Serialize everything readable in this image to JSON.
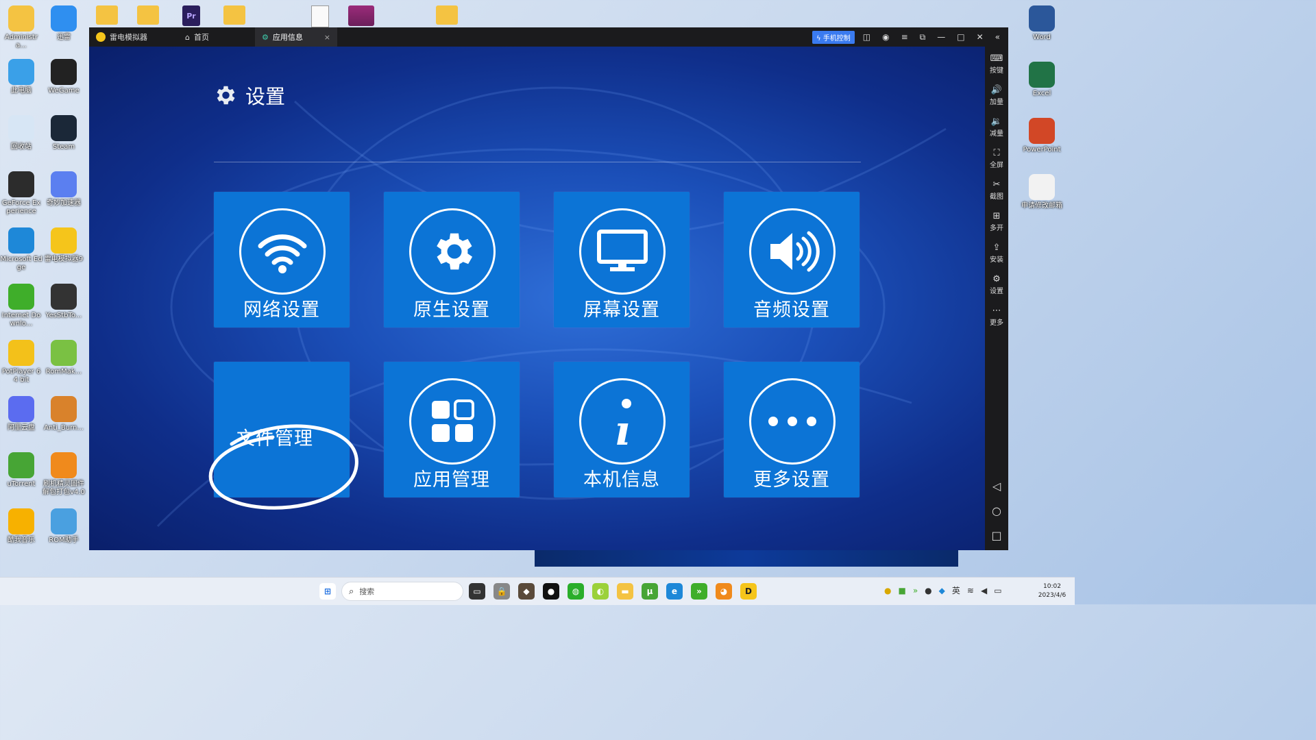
{
  "desktop_left": [
    {
      "label": "Administra...",
      "icon": "folder-icon",
      "color": "#f4c342"
    },
    {
      "label": "迅雷",
      "icon": "xunlei-icon",
      "color": "#2f8ff0"
    },
    {
      "label": "此电脑",
      "icon": "computer-icon",
      "color": "#3aa0e8"
    },
    {
      "label": "WeGame",
      "icon": "wegame-icon",
      "color": "#222222"
    },
    {
      "label": "回收站",
      "icon": "recycle-bin-icon",
      "color": "#d7e6f5"
    },
    {
      "label": "Steam",
      "icon": "steam-icon",
      "color": "#1b2838"
    },
    {
      "label": "GeForce Experience",
      "icon": "geforce-icon",
      "color": "#2c2c2c"
    },
    {
      "label": "奇妙加速器",
      "icon": "accelerator-icon",
      "color": "#5b7ff0"
    },
    {
      "label": "Microsoft Edge",
      "icon": "edge-icon",
      "color": "#1e88d8"
    },
    {
      "label": "雷电模拟器9",
      "icon": "ldplayer-icon",
      "color": "#f5c51b"
    },
    {
      "label": "Internet Downlo...",
      "icon": "idm-icon",
      "color": "#3fae2a"
    },
    {
      "label": "YesStbTo...",
      "icon": "chip-icon",
      "color": "#333333"
    },
    {
      "label": "PotPlayer 64 bit",
      "icon": "potplayer-icon",
      "color": "#f3c11a"
    },
    {
      "label": "RomMak...",
      "icon": "android-icon",
      "color": "#7ac143"
    },
    {
      "label": "阿里云盘",
      "icon": "aliyun-icon",
      "color": "#5b6cf0"
    },
    {
      "label": "Anti_Burn...",
      "icon": "antiburn-icon",
      "color": "#d9822b"
    },
    {
      "label": "uTorrent",
      "icon": "utorrent-icon",
      "color": "#47a535"
    },
    {
      "label": "刷机精灵固件解包打包v4.0",
      "icon": "fox-icon",
      "color": "#f08a1c"
    },
    {
      "label": "酷我音乐",
      "icon": "kuwo-icon",
      "color": "#f7b100"
    },
    {
      "label": "ROM助手",
      "icon": "mushroom-icon",
      "color": "#4aa0e0"
    }
  ],
  "desktop_right": [
    {
      "label": "Word",
      "icon": "word-icon",
      "color": "#2b579a"
    },
    {
      "label": "Excel",
      "icon": "excel-icon",
      "color": "#217346"
    },
    {
      "label": "PowerPoint",
      "icon": "powerpoint-icon",
      "color": "#d24726"
    },
    {
      "label": "申请修改邮箱",
      "icon": "document-icon",
      "color": "#f2f2f2"
    }
  ],
  "titlebar": {
    "app_name": "雷电模拟器",
    "tab_home": "首页",
    "tab_app": "应用信息",
    "phone_control": "手机控制"
  },
  "sidebar": [
    "按键",
    "加量",
    "减量",
    "全屏",
    "截图",
    "多开",
    "安装",
    "设置",
    "更多"
  ],
  "settings": {
    "title": "设置",
    "tiles": [
      {
        "label": "网络设置",
        "icon": "wifi-icon"
      },
      {
        "label": "原生设置",
        "icon": "gear-icon"
      },
      {
        "label": "屏幕设置",
        "icon": "monitor-icon"
      },
      {
        "label": "音频设置",
        "icon": "speaker-icon"
      },
      {
        "label": "文件管理",
        "icon": "none"
      },
      {
        "label": "应用管理",
        "icon": "apps-grid-icon"
      },
      {
        "label": "本机信息",
        "icon": "info-icon"
      },
      {
        "label": "更多设置",
        "icon": "more-dots-icon"
      }
    ]
  },
  "taskbar": {
    "search_placeholder": "搜索",
    "ime": "英",
    "time": "10:02",
    "date": "2023/4/6"
  }
}
